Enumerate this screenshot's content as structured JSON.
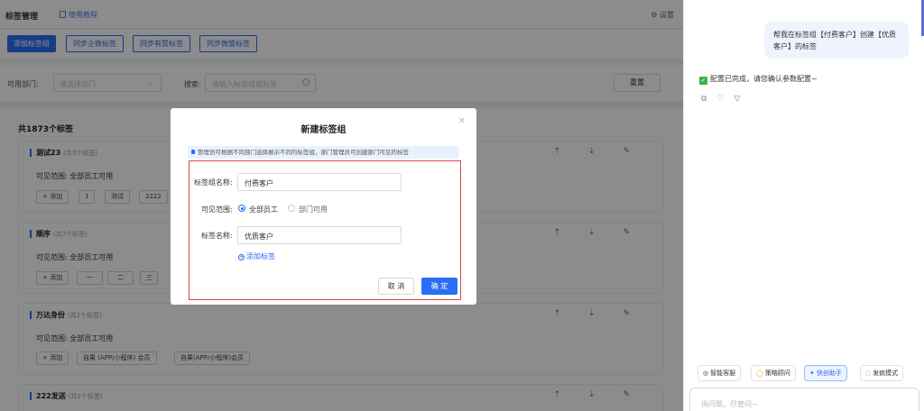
{
  "header": {
    "title": "标签管理",
    "tutorial": "使用教程",
    "settings": "设置"
  },
  "actions": {
    "add_group": "添加标签组",
    "sync_wecom": "同步企微标签",
    "sync_youzan": "同步有赞标签",
    "sync_weimob": "同步微盟标签"
  },
  "filters": {
    "dept_label": "可用部门:",
    "dept_placeholder": "请选择部门",
    "search_label": "搜索:",
    "search_placeholder": "请输入标签组或标签",
    "reset": "重置"
  },
  "list": {
    "total": "共1873个标签",
    "scope_text": "可见范围: 全部员工可用",
    "add_chip": "+ 添加",
    "groups": [
      {
        "name": "测试23",
        "count": "(共3个标签)",
        "tags": [
          "1",
          "测试",
          "2222"
        ]
      },
      {
        "name": "顺序",
        "count": "(共7个标签)",
        "tags": [
          "一",
          "二",
          "三"
        ]
      },
      {
        "name": "万达身份",
        "count": "(共2个标签)",
        "tags": [
          "自果 (APP/小程序) 会员",
          "自果(APP/小程序)会员"
        ]
      },
      {
        "name": "222发送",
        "count": "(共1个标签)",
        "tags": []
      }
    ]
  },
  "modal": {
    "title": "新建标签组",
    "notice": "管理员可根据不同部门选择展示不同的标签组，部门管理员可创建部门可见的标签",
    "group_name_label": "标签组名称:",
    "group_name_value": "付费客户",
    "visibility_label": "可见范围:",
    "visibility_options": [
      "全部员工",
      "部门可用"
    ],
    "visibility_selected": "全部员工",
    "tag_name_label": "标签名称:",
    "tag_name_value": "优质客户",
    "add_tag": "添加标签",
    "cancel": "取 消",
    "confirm": "确 定"
  },
  "assistant": {
    "user_message": "帮我在标签组【付费客户】创建【优质客户】的标签",
    "reply": "配置已完成，请您确认参数配置~",
    "quick_actions": [
      "智能客服",
      "策略顾问",
      "快创助手",
      "发疯模式"
    ],
    "quick_selected": "快创助手",
    "input_placeholder": "询问题，尽管问~"
  },
  "colors": {
    "primary": "#2b6ef5",
    "highlight_border": "#e0424c",
    "success": "#3db14a"
  }
}
